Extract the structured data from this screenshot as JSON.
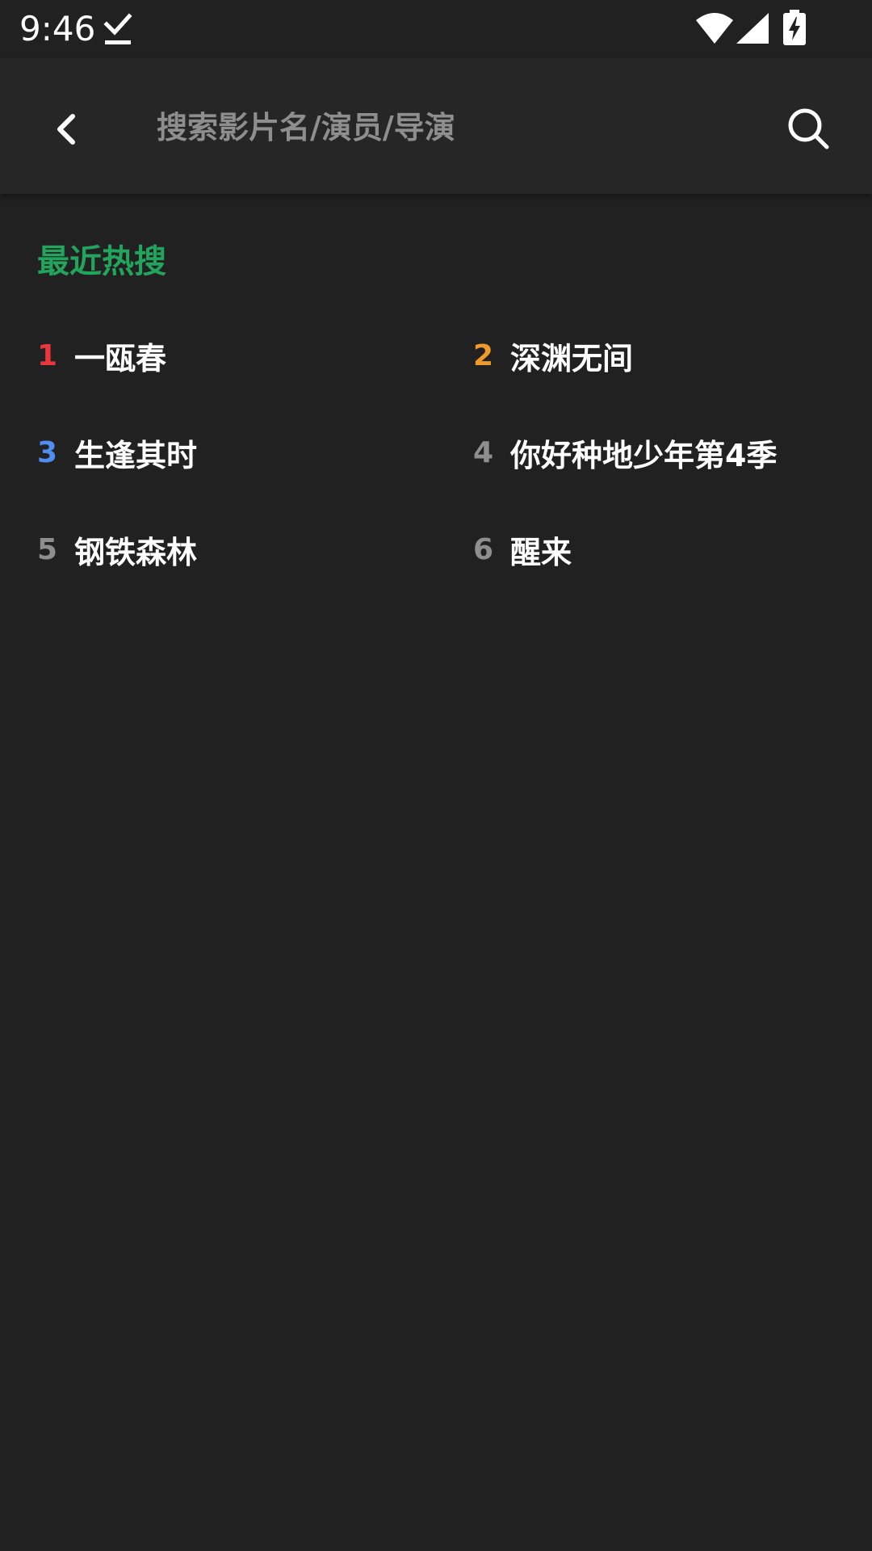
{
  "status_bar": {
    "time": "9:46",
    "icons": [
      "download-done-icon",
      "wifi-icon",
      "signal-icon",
      "battery-charging-icon"
    ]
  },
  "search": {
    "placeholder": "搜索影片名/演员/导演",
    "value": ""
  },
  "hot_search": {
    "title": "最近热搜",
    "items": [
      {
        "rank": "1",
        "label": "一瓯春",
        "rank_color": "#e8383d"
      },
      {
        "rank": "2",
        "label": "深渊无间",
        "rank_color": "#f09a2b"
      },
      {
        "rank": "3",
        "label": "生逢其时",
        "rank_color": "#4f8ef0"
      },
      {
        "rank": "4",
        "label": "你好种地少年第4季",
        "rank_color": "#8e8e8e"
      },
      {
        "rank": "5",
        "label": "钢铁森林",
        "rank_color": "#8e8e8e"
      },
      {
        "rank": "6",
        "label": "醒来",
        "rank_color": "#8e8e8e"
      }
    ]
  },
  "colors": {
    "background": "#212121",
    "header": "#262626",
    "accent_green": "#22a45d"
  }
}
